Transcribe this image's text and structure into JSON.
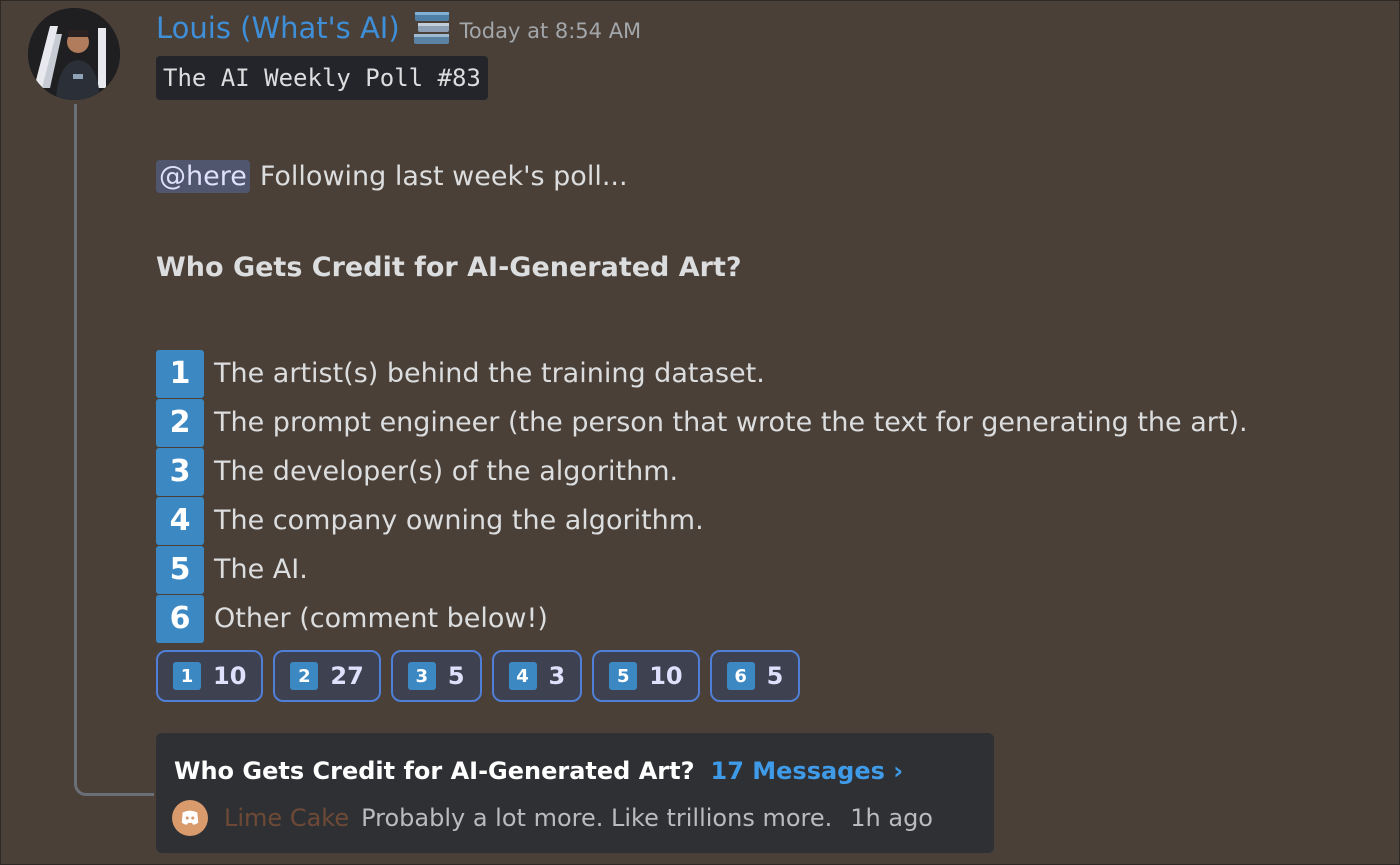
{
  "message": {
    "author": "Louis (What's AI)",
    "author_badge_icon": "books-icon",
    "timestamp": "Today at 8:54 AM",
    "code_title": "The AI Weekly Poll #83",
    "mention": "@here",
    "intro": "Following last week's poll...",
    "question": "Who Gets Credit for AI-Generated Art?",
    "options": [
      {
        "key": "1",
        "text": "The artist(s) behind the training dataset."
      },
      {
        "key": "2",
        "text": "The prompt engineer (the person that wrote the text for generating the art)."
      },
      {
        "key": "3",
        "text": "The developer(s) of the algorithm."
      },
      {
        "key": "4",
        "text": "The company owning the algorithm."
      },
      {
        "key": "5",
        "text": "The AI."
      },
      {
        "key": "6",
        "text": "Other (comment below!)"
      }
    ],
    "reactions": [
      {
        "key": "1",
        "count": "10"
      },
      {
        "key": "2",
        "count": "27"
      },
      {
        "key": "3",
        "count": "5"
      },
      {
        "key": "4",
        "count": "3"
      },
      {
        "key": "5",
        "count": "10"
      },
      {
        "key": "6",
        "count": "5"
      }
    ]
  },
  "thread": {
    "name": "Who Gets Credit for AI-Generated Art?",
    "message_count": "17 Messages ›",
    "last_user": "Lime Cake",
    "last_message": "Probably a lot more. Like trillions more.",
    "last_time": "1h ago"
  },
  "colors": {
    "background": "#4a4038",
    "author": "#3f8fd8",
    "keycap": "#3b88c3",
    "thread_link": "#3f9ae8",
    "thread_user": "#6e4a36"
  }
}
